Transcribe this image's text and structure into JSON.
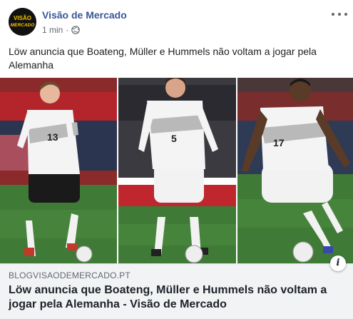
{
  "post": {
    "page_name": "Visão de Mercado",
    "time": "1 min",
    "separator": "·",
    "privacy_icon": "globe-icon",
    "more_icon": "more-options-icon",
    "text": "Löw anuncia que Boateng, Müller e Hummels não voltam a jogar pela Alemanha"
  },
  "avatar": {
    "logo_text_top": "VISÃO",
    "logo_text_bottom": "MERCADO",
    "logo_color": "#f5c400"
  },
  "photos": {
    "players": [
      {
        "name": "Müller",
        "number": "13"
      },
      {
        "name": "Hummels",
        "number": "5"
      },
      {
        "name": "Boateng",
        "number": "17"
      }
    ]
  },
  "link": {
    "domain": "BLOGVISAODEMERCADO.PT",
    "title": "Löw anuncia que Boateng, Müller e Hummels não voltam a jogar pela Alemanha - Visão de Mercado",
    "info_label": "i"
  },
  "colors": {
    "page_name": "#385898",
    "meta": "#606770",
    "link_bg": "#f2f3f5",
    "pitch": "#3f7a36"
  }
}
